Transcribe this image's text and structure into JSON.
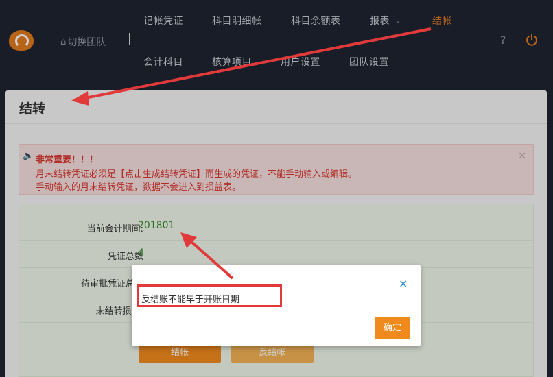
{
  "nav": {
    "row1": [
      "记帐凭证",
      "科目明细帐",
      "科目余额表",
      "报表",
      "结帐"
    ],
    "row2": [
      "会计科目",
      "核算项目",
      "用户设置",
      "团队设置"
    ],
    "team_switch": "切换团队",
    "help": "?"
  },
  "page": {
    "title": "结转",
    "alert": {
      "title": "非常重要！！！",
      "line1": "月末结转凭证必须是【点击生成结转凭证】而生成的凭证，不能手动输入或编辑。",
      "line2": "手动输入的月末结转凭证，数据不会进入到损益表。",
      "close": "×"
    },
    "info": {
      "period_label": "当前会计期间:",
      "period_value": "201801",
      "voucher_count_label": "凭证总数",
      "voucher_count_value": "4",
      "pending_label": "待审批凭证总数",
      "unclosed_label": "未结转损益:"
    },
    "buttons": {
      "close_books": "结帐",
      "reverse_close": "反结帐"
    }
  },
  "dialog": {
    "message": "反结账不能早于开账日期",
    "close": "×",
    "ok": "确定"
  },
  "colors": {
    "accent": "#e07a1f",
    "alert_red": "#d9382f",
    "annotation_red": "#e23a3a"
  }
}
